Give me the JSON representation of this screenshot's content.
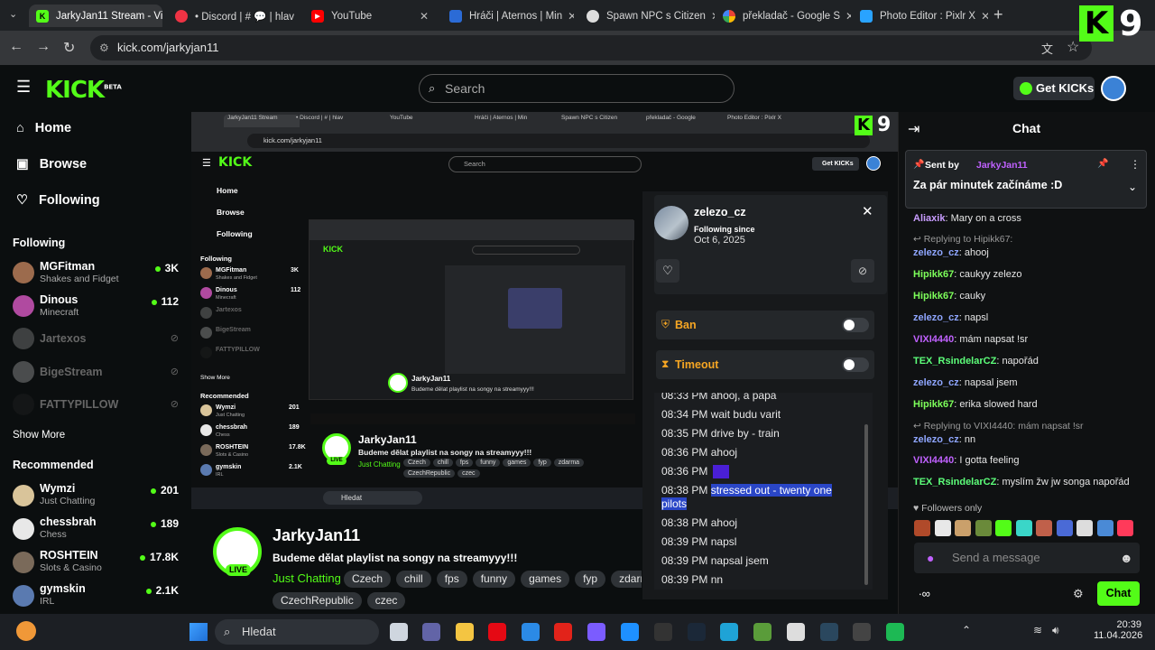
{
  "browser": {
    "tabs": [
      {
        "label": "JarkyJan11 Stream - Vi",
        "active": true
      },
      {
        "label": "• Discord | # 💬 | hlav"
      },
      {
        "label": "YouTube"
      },
      {
        "label": "Hráči | Aternos | Min"
      },
      {
        "label": "Spawn NPC s Citizen"
      },
      {
        "label": "překladač - Google S"
      },
      {
        "label": "Photo Editor : Pixlr X"
      }
    ],
    "new_tab": "+",
    "url": "kick.com/jarkyjan11"
  },
  "overlay": {
    "k_logo": "K",
    "number": "9"
  },
  "header": {
    "logo": "KICK",
    "logo_sup": "BETA",
    "search_placeholder": "Search",
    "get_kicks": "Get KICKs"
  },
  "sidebar": {
    "nav": [
      {
        "label": "Home",
        "icon": "home-icon"
      },
      {
        "label": "Browse",
        "icon": "browse-icon"
      },
      {
        "label": "Following",
        "icon": "heart-icon"
      }
    ],
    "following_title": "Following",
    "following": [
      {
        "name": "MGFitman",
        "sub": "Shakes and Fidget",
        "count": "3K",
        "live": true,
        "color": "#9c6b4d"
      },
      {
        "name": "Dinous",
        "sub": "Minecraft",
        "count": "112",
        "live": true,
        "color": "#b04aa0"
      },
      {
        "name": "Jartexos",
        "live": false,
        "color": "#8b8b8b"
      },
      {
        "name": "BigeStream",
        "live": false,
        "color": "#aaaaaa"
      },
      {
        "name": "FATTYPILLOW",
        "live": false,
        "color": "#222222"
      }
    ],
    "show_more": "Show More",
    "recommended_title": "Recommended",
    "recommended": [
      {
        "name": "Wymzi",
        "sub": "Just Chatting",
        "count": "201",
        "color": "#d9c49a"
      },
      {
        "name": "chessbrah",
        "sub": "Chess",
        "count": "189",
        "color": "#e8e8e8"
      },
      {
        "name": "ROSHTEIN",
        "sub": "Slots & Casino",
        "count": "17.8K",
        "color": "#7a6a5a"
      },
      {
        "name": "gymskin",
        "sub": "IRL",
        "count": "2.1K",
        "color": "#5a7ab0"
      }
    ]
  },
  "inner_capture": {
    "tabs": [
      "JarkyJan11 Stream",
      "• Discord | # | hlav",
      "YouTube",
      "Hráči | Aternos | Min",
      "Spawn NPC s Citizen",
      "překladač - Google",
      "Photo Editor : Pixlr X"
    ],
    "url": "kick.com/jarkyjan11",
    "logo": "KICK",
    "search": "Search",
    "get_kicks": "Get KICKs",
    "nav": [
      "Home",
      "Browse",
      "Following"
    ],
    "following_title": "Following",
    "following": [
      {
        "name": "MGFitman",
        "sub": "Shakes and Fidget",
        "count": "3K"
      },
      {
        "name": "Dinous",
        "sub": "Minecraft",
        "count": "112"
      },
      {
        "name": "Jartexos"
      },
      {
        "name": "BigeStream"
      },
      {
        "name": "FATTYPILLOW"
      }
    ],
    "show_more": "Show More",
    "recommended_title": "Recommended",
    "recommended": [
      {
        "name": "Wymzi",
        "sub": "Just Chatting",
        "count": "201"
      },
      {
        "name": "chessbrah",
        "sub": "Chess",
        "count": "189"
      },
      {
        "name": "ROSHTEIN",
        "sub": "Slots & Casino",
        "count": "17.8K"
      },
      {
        "name": "gymskin",
        "sub": "IRL",
        "count": "2.1K"
      }
    ],
    "streamer": "JarkyJan11",
    "title": "Budeme dělat playlist na songy na streamyyy!!!",
    "category": "Just Chatting",
    "tags": [
      "Czech",
      "chill",
      "fps",
      "funny",
      "games",
      "fyp",
      "zdarma",
      "CzechRepublic",
      "czec"
    ],
    "search_taskbar": "Hledat"
  },
  "user_card": {
    "username": "zelezo_cz",
    "following_since_label": "Following since",
    "following_since": "Oct 6, 2025",
    "ban_label": "Ban",
    "timeout_label": "Timeout"
  },
  "message_history": [
    {
      "time": "08:33 PM",
      "text": "ahooj, a papa"
    },
    {
      "time": "08:34 PM",
      "text": "wait budu varit"
    },
    {
      "time": "08:35 PM",
      "text": "drive by - train"
    },
    {
      "time": "08:36 PM",
      "text": "ahooj"
    },
    {
      "time": "08:36 PM",
      "text": "",
      "emote": true
    },
    {
      "time": "08:38 PM",
      "text": "stressed out - twenty one",
      "text2": "pilots",
      "selected": true
    },
    {
      "time": "08:38 PM",
      "text": "ahooj"
    },
    {
      "time": "08:39 PM",
      "text": "napsl"
    },
    {
      "time": "08:39 PM",
      "text": "napsal jsem"
    },
    {
      "time": "08:39 PM",
      "text": "nn"
    }
  ],
  "stream": {
    "streamer": "JarkyJan11",
    "live_badge": "LIVE",
    "title": "Budeme dělat playlist na songy na streamyyy!!!",
    "category": "Just Chatting",
    "tags": [
      "Czech",
      "chill",
      "fps",
      "funny",
      "games",
      "fyp",
      "zdarm",
      "CzechRepublic",
      "czec"
    ]
  },
  "chat": {
    "title": "Chat",
    "pinned_sent_by": "Sent by",
    "pinned_user": "JarkyJan11",
    "pinned_message": "Za pár minutek začínáme :D",
    "messages": [
      {
        "user": "Aliaxik",
        "color": "#c89cff",
        "text": "Mary on a cross"
      },
      {
        "reply": "Replying to Hipikk67:"
      },
      {
        "user": "zelezo_cz",
        "color": "#8fa6ff",
        "text": "ahooj"
      },
      {
        "user": "Hipikk67",
        "color": "#7dff5a",
        "text": "caukyy zelezo"
      },
      {
        "user": "Hipikk67",
        "color": "#7dff5a",
        "text": "cauky"
      },
      {
        "user": "zelezo_cz",
        "color": "#8fa6ff",
        "text": "napsl"
      },
      {
        "user": "VIXI4440",
        "color": "#c061ff",
        "text": "mám napsat !sr"
      },
      {
        "user": "TEX_RsindelarCZ",
        "color": "#5dff7a",
        "text": "napořád"
      },
      {
        "user": "zelezo_cz",
        "color": "#8fa6ff",
        "text": "napsal jsem"
      },
      {
        "user": "Hipikk67",
        "color": "#7dff5a",
        "text": "erika slowed hard"
      },
      {
        "reply": "Replying to VIXI4440: mám napsat !sr"
      },
      {
        "user": "zelezo_cz",
        "color": "#8fa6ff",
        "text": "nn"
      },
      {
        "user": "VIXI4440",
        "color": "#c061ff",
        "text": "I gotta feeling"
      },
      {
        "user": "TEX_RsindelarCZ",
        "color": "#5dff7a",
        "text": "myslím žw jw songa napořád"
      }
    ],
    "followers_only": "Followers only",
    "send_placeholder": "Send a message",
    "chat_button": "Chat"
  },
  "taskbar": {
    "search": "Hledat",
    "time": "20:39",
    "date": "11.04.2026"
  },
  "colors": {
    "accent": "#53fc18",
    "selection": "#2a46c7"
  }
}
